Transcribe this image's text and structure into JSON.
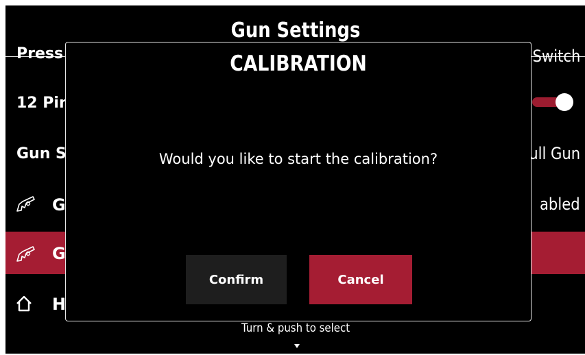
{
  "header": {
    "title": "Gun Settings"
  },
  "background_list": {
    "rows": [
      {
        "left_text": "Press",
        "right_text": "Switch"
      },
      {
        "left_text": "12 Pin",
        "toggle_on": true
      },
      {
        "left_text": "Gun S",
        "right_text": "ull Gun"
      },
      {
        "icon": "gun-icon",
        "left_text": "G",
        "right_text": "abled"
      },
      {
        "icon": "gun-icon",
        "left_text": "G",
        "selected": true
      },
      {
        "icon": "home-icon",
        "left_text": "H"
      }
    ]
  },
  "dialog": {
    "title": "CALIBRATION",
    "message": "Would you like to start the calibration?",
    "confirm_label": "Confirm",
    "cancel_label": "Cancel"
  },
  "footer": {
    "hint": "Turn & push to select",
    "arrow_icon": "down-arrow-icon"
  },
  "colors": {
    "background": "#000000",
    "accent": "#a51d33",
    "secondary_button": "#1e1e1e",
    "text": "#ffffff"
  }
}
